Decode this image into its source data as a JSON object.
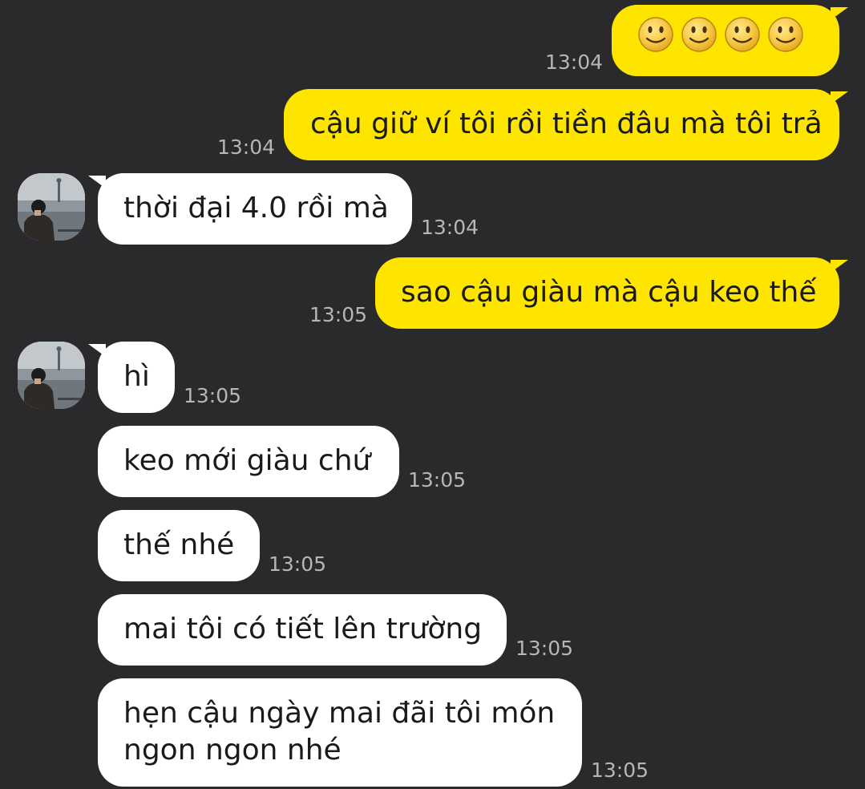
{
  "colors": {
    "background": "#2a2a2c",
    "outgoing_bubble": "#fee500",
    "incoming_bubble": "#ffffff",
    "timestamp": "#b6b6b8"
  },
  "contact": {
    "avatar_icon": "profile-photo"
  },
  "messages": [
    {
      "direction": "outgoing",
      "content": "emoji",
      "emoji_icon": "slightly-smiling-face-icon",
      "emoji_count": 4,
      "time": "13:04"
    },
    {
      "direction": "outgoing",
      "text": "cậu giữ ví tôi rồi tiền đâu mà tôi trả",
      "time": "13:04"
    },
    {
      "direction": "incoming",
      "text": "thời đại 4.0 rồi mà",
      "time": "13:04"
    },
    {
      "direction": "outgoing",
      "text": "sao cậu giàu mà cậu keo thế",
      "time": "13:05"
    },
    {
      "direction": "incoming",
      "text": "hì",
      "time": "13:05"
    },
    {
      "direction": "incoming",
      "text": "keo mới giàu chứ",
      "time": "13:05"
    },
    {
      "direction": "incoming",
      "text": "thế nhé",
      "time": "13:05"
    },
    {
      "direction": "incoming",
      "text": "mai tôi có tiết lên trường",
      "time": "13:05"
    },
    {
      "direction": "incoming",
      "text": "hẹn cậu ngày mai đãi tôi món ngon ngon nhé",
      "time": "13:05"
    }
  ]
}
